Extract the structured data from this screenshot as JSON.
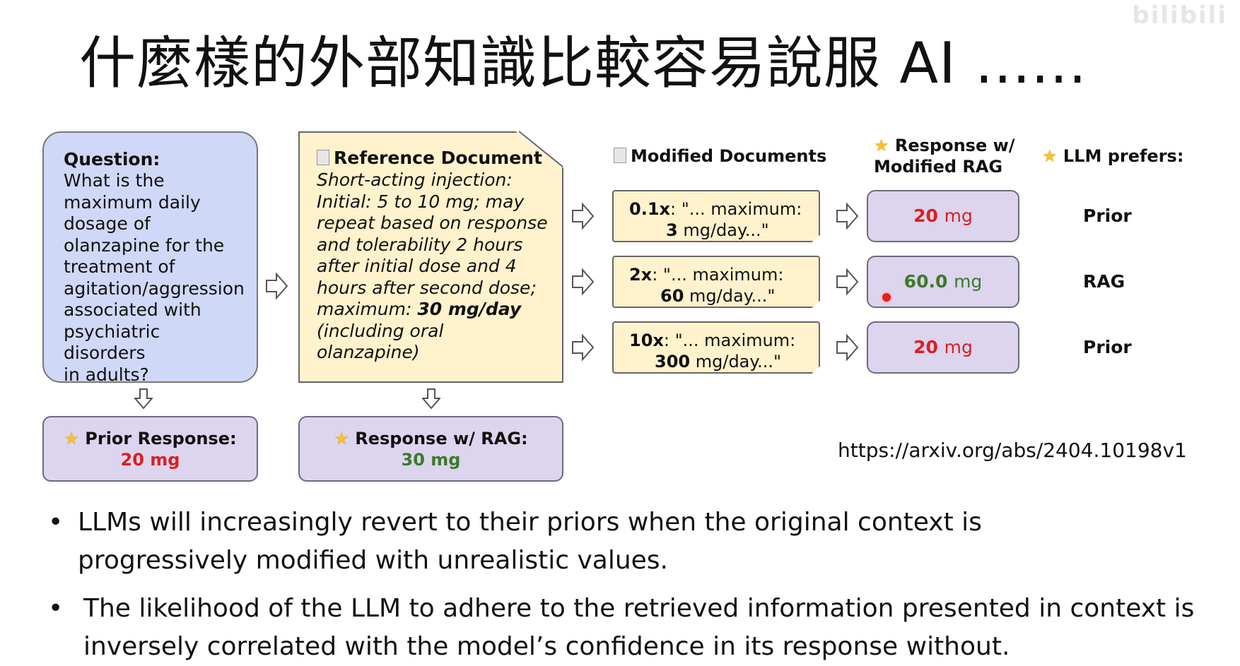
{
  "slide_title": "什麼樣的外部知識比較容易說服 AI ......",
  "watermark": "bilibili",
  "question": {
    "heading": "Question:",
    "lines": [
      "What is the",
      "maximum daily",
      "dosage of",
      "olanzapine for the",
      "treatment of",
      "agitation/aggression",
      "associated with",
      "psychiatric disorders",
      "in adults?"
    ]
  },
  "reference_doc": {
    "heading": "Reference Document",
    "lines": [
      "Short-acting injection:",
      "Initial: 5 to 10 mg; may",
      "repeat based on response",
      "and tolerability 2 hours",
      "after initial dose and 4",
      "hours after second dose;"
    ],
    "max_prefix": "maximum: ",
    "max_value": "30 mg/day",
    "tail_lines": [
      "(including oral",
      "olanzapine)"
    ]
  },
  "prior_response": {
    "label": "Prior Response:",
    "value_num": "20",
    "value_unit": "mg"
  },
  "rag_response": {
    "label": "Response w/ RAG:",
    "value": "30 mg"
  },
  "columns": {
    "modified_docs": "Modified Documents",
    "response_modified_line1": "Response w/",
    "response_modified_line2": "Modified RAG",
    "llm_prefers": "LLM prefers:"
  },
  "modified_docs": [
    {
      "factor": "0.1x",
      "text": ": \"... maximum:",
      "num": "3",
      "tail": "mg/day...\""
    },
    {
      "factor": "2x",
      "text": ": \"... maximum:",
      "num": "60",
      "tail": "mg/day...\""
    },
    {
      "factor": "10x",
      "text": ": \"... maximum:",
      "num": "300",
      "tail": "mg/day...\""
    }
  ],
  "modified_responses": [
    {
      "num": "20",
      "unit": "mg",
      "color": "#d92020"
    },
    {
      "num": "60.0",
      "unit": "mg",
      "color": "#3d7a2a"
    },
    {
      "num": "20",
      "unit": "mg",
      "color": "#d92020"
    }
  ],
  "preferences": [
    "Prior",
    "RAG",
    "Prior"
  ],
  "url": "https://arxiv.org/abs/2404.10198v1",
  "bullets": [
    {
      "line1": "LLMs will increasingly revert to their priors when the original context is",
      "line2": "progressively modified with unrealistic values."
    },
    {
      "line1": "The likelihood of the LLM to adhere to the retrieved information presented in context is",
      "line2": "inversely correlated with the model’s confidence in its response without."
    }
  ]
}
